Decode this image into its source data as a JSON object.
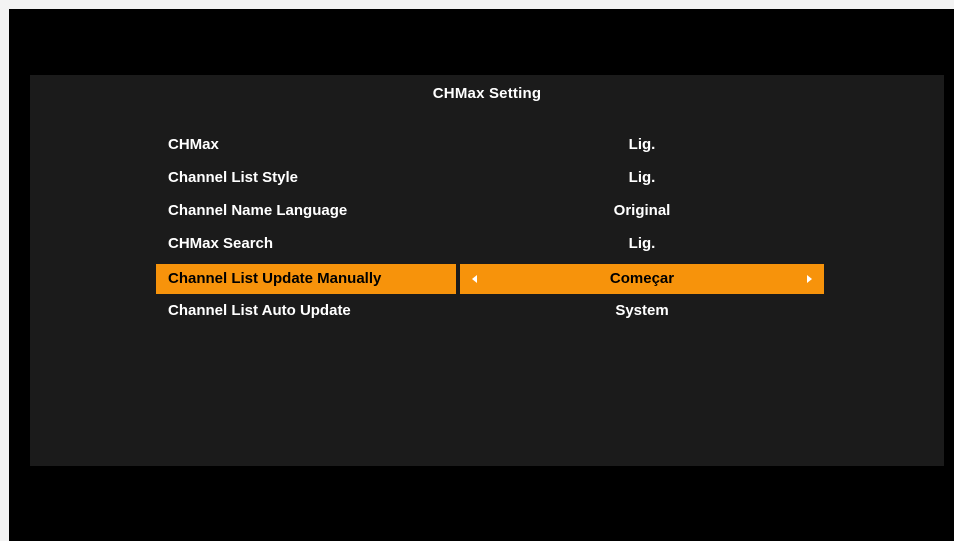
{
  "menu": {
    "title": "CHMax Setting",
    "items": [
      {
        "label": "CHMax",
        "value": "Lig."
      },
      {
        "label": "Channel List Style",
        "value": "Lig."
      },
      {
        "label": "Channel Name Language",
        "value": "Original"
      },
      {
        "label": "CHMax Search",
        "value": "Lig."
      },
      {
        "label": "Channel List Update Manually",
        "value": "Começar"
      },
      {
        "label": "Channel List Auto Update",
        "value": "System"
      }
    ],
    "selected_index": 4
  },
  "colors": {
    "highlight": "#f7930b",
    "panel_background": "#1b1b1b",
    "screen_background": "#000000",
    "text": "#ffffff"
  }
}
